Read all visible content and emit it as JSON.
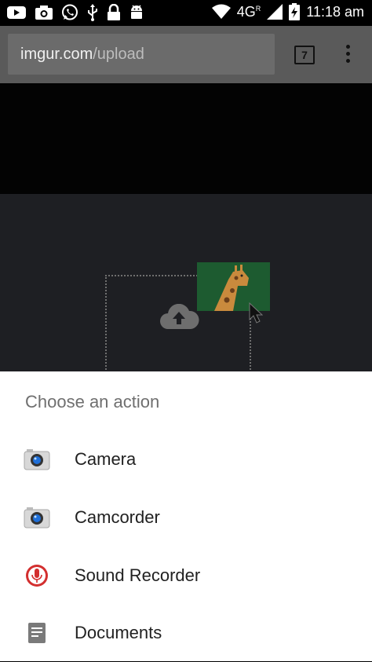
{
  "status_bar": {
    "network_label": "4G",
    "roaming_marker": "R",
    "time": "11:18 am",
    "left_icons": [
      "youtube-icon",
      "camera-icon",
      "whatsapp-icon",
      "usb-icon",
      "lock-icon",
      "android-icon"
    ],
    "right_icons": [
      "wifi-icon",
      "signal-icon",
      "battery-charging-icon"
    ]
  },
  "browser": {
    "url_host": "imgur.com",
    "url_path": "/upload",
    "tab_count": "7",
    "menu_icon": "overflow-menu-icon"
  },
  "page": {
    "upload_icon": "cloud-upload-icon",
    "thumbnail_icon": "giraffe-icon",
    "cursor_icon": "mouse-pointer-icon"
  },
  "chooser": {
    "title": "Choose an action",
    "actions": [
      {
        "label": "Camera",
        "icon": "camera-app-icon"
      },
      {
        "label": "Camcorder",
        "icon": "camcorder-app-icon"
      },
      {
        "label": "Sound Recorder",
        "icon": "microphone-icon"
      },
      {
        "label": "Documents",
        "icon": "documents-icon"
      }
    ]
  },
  "colors": {
    "sheet_background": "#ffffff",
    "scrim_dimmed_toolbar": "#5a5a5a",
    "page_background": "#1e1f23",
    "thumbnail_green": "#1d5b30",
    "recorder_red": "#d32f2f"
  }
}
